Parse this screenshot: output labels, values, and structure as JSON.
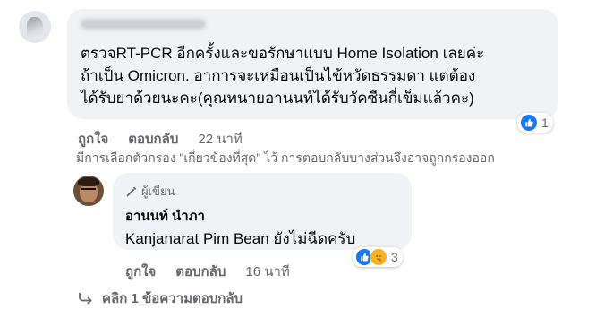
{
  "comment": {
    "author_blurred": "Kanjanarat Pim Bean",
    "lines": [
      "ตรวจRT-PCR อีกครั้งและขอรักษาแบบ Home Isolation เลยค่ะ",
      "ถ้าเป็น Omicron. อาการจะเหมือนเป็นไข้หวัดธรรมดา แต่ต้อง",
      "ได้รับยาด้วยนะคะ(คุณทนายอานนท์ได้รับวัคซีนกี่เข็มแล้วคะ)"
    ],
    "reaction_count": "1",
    "like_label": "ถูกใจ",
    "reply_label": "ตอบกลับ",
    "time": "22 นาที"
  },
  "filter_note": "มีการเลือกตัวกรอง \"เกี่ยวข้องที่สุด\" ไว้ การตอบกลับบางส่วนจึงอาจถูกกรองออก",
  "reply": {
    "author_badge": "ผู้เขียน",
    "author_name": "อานนท์ นำภา",
    "text": "Kanjanarat Pim Bean ยังไม่ฉีดครับ",
    "reaction_count": "3",
    "like_label": "ถูกใจ",
    "reply_label": "ตอบกลับ",
    "time": "16 นาที"
  },
  "more_replies_label": "คลิก 1 ข้อความตอบกลับ",
  "colors": {
    "bubble": "#f0f2f5",
    "secondary_text": "#65676b",
    "like_blue": "#1877f2",
    "care_yellow": "#f7b125"
  },
  "icons": [
    "like-icon",
    "care-icon",
    "pencil-icon",
    "reply-arrow-icon"
  ]
}
